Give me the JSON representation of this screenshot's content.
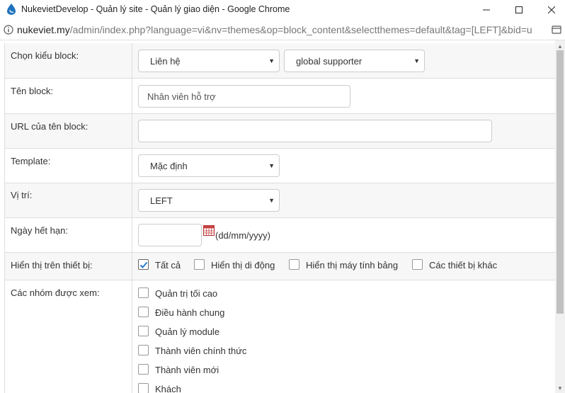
{
  "window": {
    "title": "NukevietDevelop - Quản lý site - Quản lý giao diện - Google Chrome",
    "minimize_symbol": "—",
    "maximize_symbol": "☐",
    "close_symbol": "✕"
  },
  "addressbar": {
    "host": "nukeviet.my",
    "path": "/admin/index.php?language=vi&nv=themes&op=block_content&selectthemes=default&tag=[LEFT]&bid=u"
  },
  "form": {
    "block_type": {
      "label": "Chọn kiểu block:",
      "module_value": "Liên hệ",
      "block_value": "global supporter"
    },
    "block_name": {
      "label": "Tên block:",
      "value": "Nhân viên hỗ trợ"
    },
    "block_url": {
      "label": "URL của tên block:",
      "value": ""
    },
    "template": {
      "label": "Template:",
      "value": "Mặc định"
    },
    "position": {
      "label": "Vị trí:",
      "value": "LEFT"
    },
    "expiry": {
      "label": "Ngày hết hạn:",
      "value": "",
      "hint": "(dd/mm/yyyy)"
    },
    "devices": {
      "label": "Hiển thị trên thiết bị:",
      "options": [
        {
          "label": "Tất cả",
          "checked": true
        },
        {
          "label": "Hiển thị di động",
          "checked": false
        },
        {
          "label": "Hiển thị máy tính bảng",
          "checked": false
        },
        {
          "label": "Các thiết bị khác",
          "checked": false
        }
      ]
    },
    "groups": {
      "label": "Các nhóm được xem:",
      "options": [
        {
          "label": "Quản trị tối cao",
          "checked": false
        },
        {
          "label": "Điều hành chung",
          "checked": false
        },
        {
          "label": "Quản lý module",
          "checked": false
        },
        {
          "label": "Thành viên chính thức",
          "checked": false
        },
        {
          "label": "Thành viên mới",
          "checked": false
        },
        {
          "label": "Khách",
          "checked": false
        }
      ]
    }
  },
  "colors": {
    "row_alt": "#f7f7f7",
    "border": "#dddddd",
    "check_accent": "#2a7ccc"
  }
}
